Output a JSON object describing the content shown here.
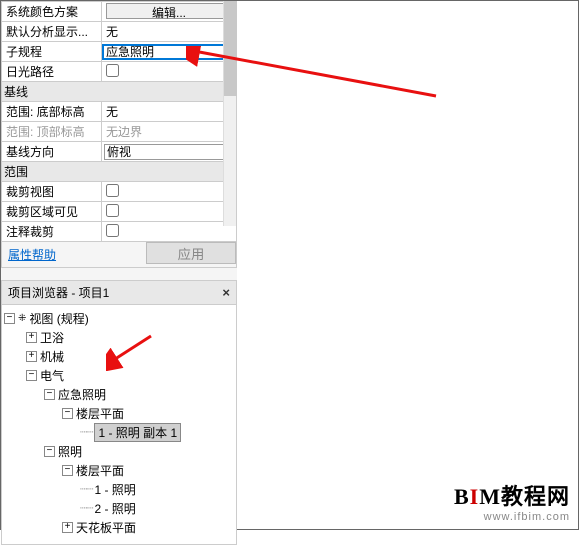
{
  "props": {
    "colorScheme": {
      "label": "系统颜色方案",
      "editBtn": "编辑..."
    },
    "defaultDisplay": {
      "label": "默认分析显示...",
      "value": "无"
    },
    "subDiscipline": {
      "label": "子规程",
      "value": "应急照明"
    },
    "sunPath": {
      "label": "日光路径",
      "checked": false
    },
    "baselineCat": "基线",
    "bottomElev": {
      "label": "范围: 底部标高",
      "value": "无"
    },
    "topElev": {
      "label": "范围: 顶部标高",
      "value": "无边界"
    },
    "baselineDir": {
      "label": "基线方向",
      "value": "俯视"
    },
    "extentsCat": "范围",
    "cropView": {
      "label": "裁剪视图",
      "checked": false
    },
    "cropRegion": {
      "label": "裁剪区域可见",
      "checked": false
    },
    "annoCrop": {
      "label": "注释裁剪",
      "checked": false
    }
  },
  "footer": {
    "help": "属性帮助",
    "apply": "应用"
  },
  "browser": {
    "title": "项目浏览器 - 项目1",
    "viewsRoot": "视图 (规程)",
    "plumbing": "卫浴",
    "mechanical": "机械",
    "electrical": "电气",
    "emergency": "应急照明",
    "floorPlans": "楼层平面",
    "plan1copy": "1 - 照明 副本 1",
    "lighting": "照明",
    "plan1": "1 - 照明",
    "plan2": "2 - 照明",
    "ceiling": "天花板平面"
  },
  "site": {
    "name": "BIM教程网",
    "url": "www.ifbim.com"
  }
}
